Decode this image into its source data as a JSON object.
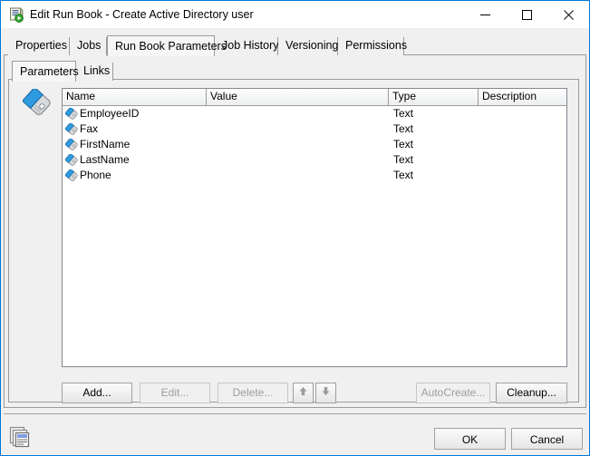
{
  "window": {
    "title": "Edit Run Book - Create Active Directory user",
    "icon": "runbook-icon",
    "accent_color": "#0078d7",
    "controls": {
      "minimize": "minimize-icon",
      "maximize": "maximize-icon",
      "close": "close-icon"
    }
  },
  "tabs": [
    {
      "label": "Properties",
      "selected": false
    },
    {
      "label": "Jobs",
      "selected": false
    },
    {
      "label": "Run Book Parameters",
      "selected": true
    },
    {
      "label": "Job History",
      "selected": false
    },
    {
      "label": "Versioning",
      "selected": false
    },
    {
      "label": "Permissions",
      "selected": false
    }
  ],
  "inner_tabs": [
    {
      "label": "Parameters",
      "selected": true
    },
    {
      "label": "Links",
      "selected": false
    }
  ],
  "side_icon": "tag-icon",
  "list": {
    "columns": [
      "Name",
      "Value",
      "Type",
      "Description"
    ],
    "rows": [
      {
        "icon": "tag-icon",
        "name": "EmployeeID",
        "value": "",
        "type": "Text",
        "description": ""
      },
      {
        "icon": "tag-icon",
        "name": "Fax",
        "value": "",
        "type": "Text",
        "description": ""
      },
      {
        "icon": "tag-icon",
        "name": "FirstName",
        "value": "",
        "type": "Text",
        "description": ""
      },
      {
        "icon": "tag-icon",
        "name": "LastName",
        "value": "",
        "type": "Text",
        "description": ""
      },
      {
        "icon": "tag-icon",
        "name": "Phone",
        "value": "",
        "type": "Text",
        "description": ""
      }
    ]
  },
  "panel_buttons": {
    "add": {
      "label": "Add...",
      "enabled": true
    },
    "edit": {
      "label": "Edit...",
      "enabled": false
    },
    "delete": {
      "label": "Delete...",
      "enabled": false
    },
    "move_up": {
      "icon": "arrow-up-icon",
      "enabled": false
    },
    "move_down": {
      "icon": "arrow-down-icon",
      "enabled": false
    },
    "autocreate": {
      "label": "AutoCreate...",
      "enabled": false
    },
    "cleanup": {
      "label": "Cleanup...",
      "enabled": true
    }
  },
  "footer": {
    "icon": "copy-windows-icon",
    "ok": "OK",
    "cancel": "Cancel"
  }
}
